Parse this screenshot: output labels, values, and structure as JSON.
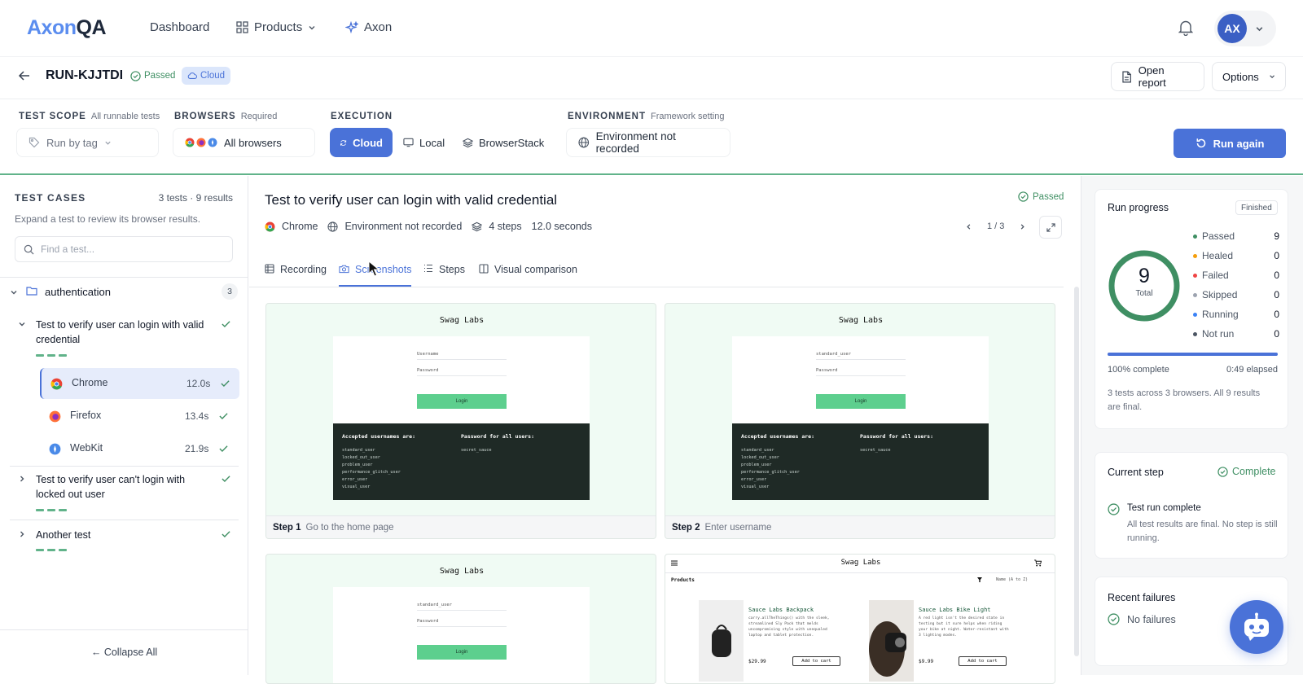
{
  "brand": {
    "logo_part1": "Axon",
    "logo_part2": "QA"
  },
  "nav": {
    "dashboard": "Dashboard",
    "products": "Products",
    "axon": "Axon"
  },
  "user": {
    "initials": "AX"
  },
  "run": {
    "id": "RUN-KJJTDI",
    "status": "Passed",
    "env_badge": "Cloud",
    "open_report": "Open report",
    "options": "Options"
  },
  "config": {
    "test_scope": {
      "label": "TEST SCOPE",
      "hint": "All runnable tests",
      "value": "Run by tag"
    },
    "browsers": {
      "label": "BROWSERS",
      "hint": "Required",
      "value": "All browsers"
    },
    "execution": {
      "label": "EXECUTION",
      "options": [
        "Cloud",
        "Local",
        "BrowserStack"
      ],
      "selected": "Cloud"
    },
    "environment": {
      "label": "ENVIRONMENT",
      "hint": "Framework setting",
      "value": "Environment not recorded"
    },
    "run_again": "Run again"
  },
  "test_cases": {
    "title": "TEST CASES",
    "summary": "3 tests · 9 results",
    "help": "Expand a test to review its browser results.",
    "search_placeholder": "Find a test...",
    "group": {
      "name": "authentication",
      "count": "3"
    },
    "tests": [
      {
        "name": "Test to verify user can login with valid credential",
        "browsers": [
          {
            "name": "Chrome",
            "time": "12.0s"
          },
          {
            "name": "Firefox",
            "time": "13.4s"
          },
          {
            "name": "WebKit",
            "time": "21.9s"
          }
        ]
      },
      {
        "name": "Test to verify user can't login with locked out user"
      },
      {
        "name": "Another test"
      }
    ],
    "collapse_all": "← Collapse All"
  },
  "detail": {
    "title": "Test to verify user can login with valid credential",
    "status": "Passed",
    "browser": "Chrome",
    "environment": "Environment not recorded",
    "steps": "4 steps",
    "duration": "12.0 seconds",
    "pager": "1 / 3",
    "tabs": [
      "Recording",
      "Screenshots",
      "Steps",
      "Visual comparison"
    ],
    "active_tab": "Screenshots",
    "screenshots": [
      {
        "step": "Step 1",
        "desc": "Go to the home page",
        "user_field": "Username"
      },
      {
        "step": "Step 2",
        "desc": "Enter username",
        "user_field": "standard_user"
      },
      {
        "step": "",
        "desc": "",
        "user_field": "standard_user"
      }
    ],
    "app": {
      "title": "Swag Labs",
      "password_label": "Password",
      "login": "Login",
      "accepted_heading": "Accepted usernames are:",
      "usernames": [
        "standard_user",
        "locked_out_user",
        "problem_user",
        "performance_glitch_user",
        "error_user",
        "visual_user"
      ],
      "password_heading": "Password for all users:",
      "password_value": "secret_sauce",
      "products_heading": "Products",
      "sort": "Name (A to Z)",
      "products": [
        {
          "name": "Sauce Labs Backpack",
          "desc": "carry.allTheThings() with the sleek, streamlined Sly Pack that melds uncompromising style with unequaled laptop and tablet protection.",
          "price": "$29.99",
          "button": "Add to cart"
        },
        {
          "name": "Sauce Labs Bike Light",
          "desc": "A red light isn't the desired state in testing but it sure helps when riding your bike at night. Water-resistant with 3 lighting modes.",
          "price": "$9.99",
          "button": "Add to cart"
        }
      ]
    }
  },
  "progress": {
    "title": "Run progress",
    "badge": "Finished",
    "total": "9",
    "total_label": "Total",
    "fraction_complete": 1.0,
    "legend": [
      {
        "label": "Passed",
        "value": "9",
        "color": "#3f8f63"
      },
      {
        "label": "Healed",
        "value": "0",
        "color": "#f59e0b"
      },
      {
        "label": "Failed",
        "value": "0",
        "color": "#ef4444"
      },
      {
        "label": "Skipped",
        "value": "0",
        "color": "#9ca3af"
      },
      {
        "label": "Running",
        "value": "0",
        "color": "#3b82f6"
      },
      {
        "label": "Not run",
        "value": "0",
        "color": "#4b5563"
      }
    ],
    "complete": "100% complete",
    "elapsed": "0:49 elapsed",
    "note": "3 tests across 3 browsers. All 9 results are final."
  },
  "current_step": {
    "title": "Current step",
    "status": "Complete",
    "item": "Test run complete",
    "note": "All test results are final. No step is still running."
  },
  "failures": {
    "title": "Recent failures",
    "value": "No failures"
  },
  "colors": {
    "accent": "#4a72d8",
    "success": "#3f8f63",
    "ring": "#3f8f63"
  }
}
